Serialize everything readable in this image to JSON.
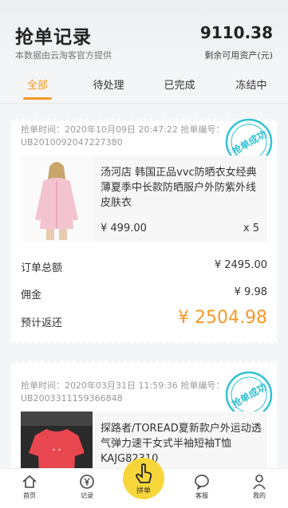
{
  "header": {
    "title": "抢单记录",
    "subtitle": "本数据由云淘客官方提供",
    "assets_value": "9110.38",
    "assets_label": "剩余可用资产(元)"
  },
  "tabs": [
    {
      "label": "全部",
      "active": true
    },
    {
      "label": "待处理",
      "active": false
    },
    {
      "label": "已完成",
      "active": false
    },
    {
      "label": "冻结中",
      "active": false
    }
  ],
  "orders": [
    {
      "meta": "抢单时间：2020年10月09日 20:47:22 抢单编号：UB2010092047227380",
      "stamp": "抢单成功",
      "product_name": "汤河店 韩国正品vvc防晒衣女经典薄夏季中长款防晒服户外防紫外线皮肤衣",
      "price": "¥ 499.00",
      "qty": "x 5",
      "total_label": "订单总额",
      "total_value": "¥ 2495.00",
      "commission_label": "佣金",
      "commission_value": "¥ 9.98",
      "refund_label": "预计返还",
      "refund_value": "¥ 2504.98"
    },
    {
      "meta": "抢单时间：2020年03月31日 11:59:36 抢单编号：UB2003311159366848",
      "stamp": "抢单成功",
      "product_name": "探路者/TOREAD夏新款户外运动透气弹力速干女式半袖短袖T恤KAJG82310"
    }
  ],
  "nav": [
    {
      "label": "首页",
      "icon": "home-icon"
    },
    {
      "label": "记录",
      "icon": "yen-circle-icon"
    },
    {
      "label": "拼单",
      "icon": "tap-hand-icon"
    },
    {
      "label": "客服",
      "icon": "chat-icon"
    },
    {
      "label": "我的",
      "icon": "user-icon"
    }
  ],
  "colors": {
    "accent": "#f39a2a",
    "stamp": "#2fc3d3",
    "center_button": "#f7d63a"
  }
}
